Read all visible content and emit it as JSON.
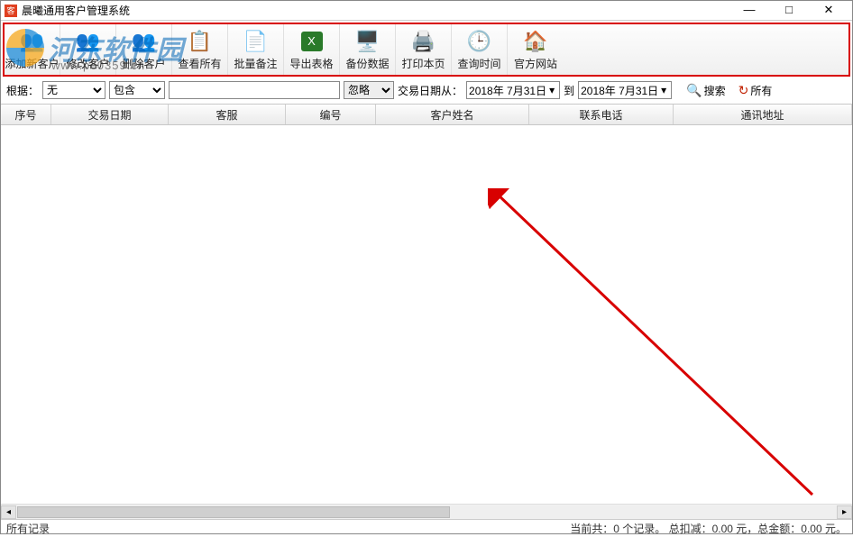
{
  "window": {
    "title": "晨曦通用客户管理系统",
    "min": "—",
    "max": "□",
    "close": "✕"
  },
  "watermark": {
    "text": "河东软件园",
    "url": "www.pc0359.cn"
  },
  "toolbar": [
    {
      "key": "add",
      "label": "添加新客户"
    },
    {
      "key": "edit",
      "label": "修改客户"
    },
    {
      "key": "del",
      "label": "删除客户"
    },
    {
      "key": "view",
      "label": "查看所有"
    },
    {
      "key": "batch",
      "label": "批量备注"
    },
    {
      "key": "export",
      "label": "导出表格"
    },
    {
      "key": "backup",
      "label": "备份数据"
    },
    {
      "key": "print",
      "label": "打印本页"
    },
    {
      "key": "time",
      "label": "查询时间"
    },
    {
      "key": "web",
      "label": "官方网站"
    }
  ],
  "filter": {
    "label_root": "根据：",
    "sel1": "无",
    "sel2": "包含",
    "textval": "",
    "sel3": "忽略",
    "label_date": "交易日期从：",
    "date_from": "2018年 7月31日",
    "label_to": "到",
    "date_to": "2018年 7月31日",
    "btn_search": "搜索",
    "btn_all": "所有"
  },
  "columns": [
    "序号",
    "交易日期",
    "客服",
    "编号",
    "客户姓名",
    "联系电话",
    "通讯地址"
  ],
  "status": {
    "left": "所有记录",
    "right": "当前共：0 个记录。 总扣减：0.00 元，总金额：0.00 元。"
  }
}
